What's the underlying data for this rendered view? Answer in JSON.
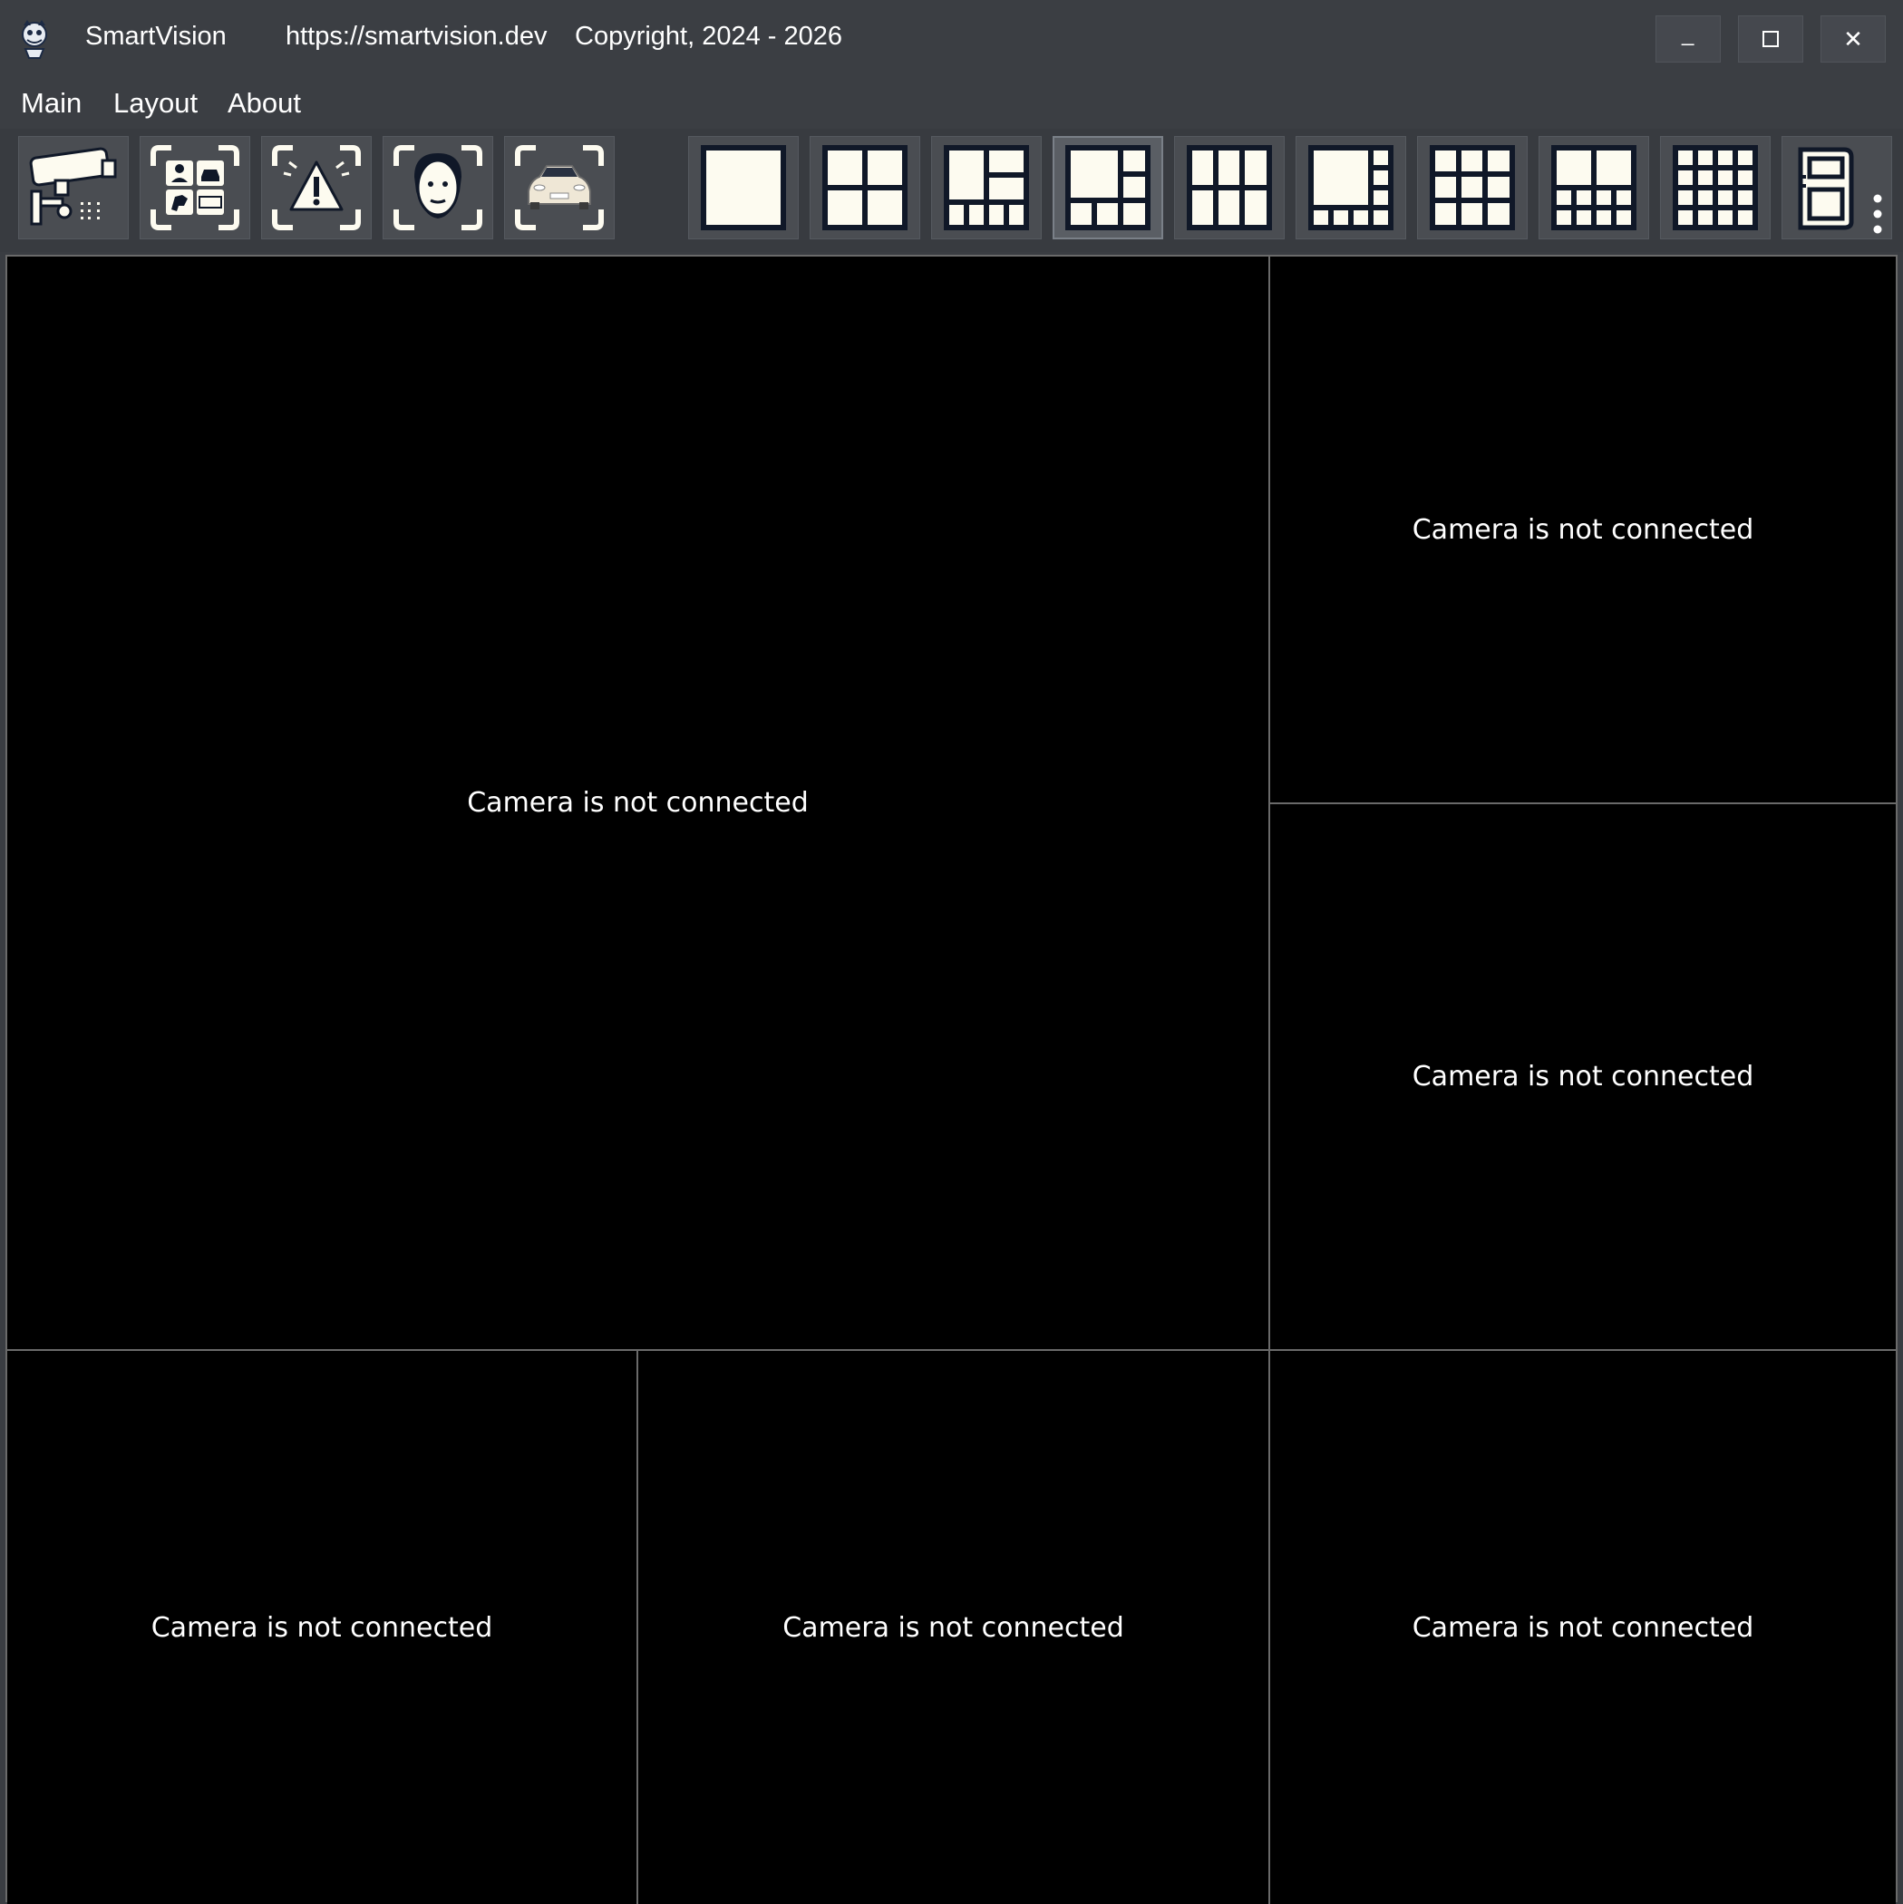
{
  "titlebar": {
    "app_name": "SmartVision",
    "url": "https://smartvision.dev",
    "copyright": "Copyright, 2024 - 2026",
    "minimize_label": "_",
    "close_label": "✕"
  },
  "menu": {
    "items": [
      "Main",
      "Layout",
      "About"
    ]
  },
  "toolbar": {
    "feature_buttons": [
      {
        "icon": "cctv-camera-icon"
      },
      {
        "icon": "object-detection-icon"
      },
      {
        "icon": "alert-icon"
      },
      {
        "icon": "face-recognition-icon"
      },
      {
        "icon": "vehicle-recognition-icon"
      }
    ],
    "layout_buttons": [
      {
        "icon": "layout-1-icon"
      },
      {
        "icon": "layout-4-icon"
      },
      {
        "icon": "layout-1-plus-4-icon"
      },
      {
        "icon": "layout-1-plus-5-icon",
        "selected": true
      },
      {
        "icon": "layout-6-icon"
      },
      {
        "icon": "layout-1-plus-7-icon"
      },
      {
        "icon": "layout-9-icon"
      },
      {
        "icon": "layout-1-plus-8-icon"
      },
      {
        "icon": "layout-16-icon"
      },
      {
        "icon": "custom-layout-icon"
      }
    ]
  },
  "cameras": [
    {
      "status": "Camera is not connected"
    },
    {
      "status": "Camera is not connected"
    },
    {
      "status": "Camera is not connected"
    },
    {
      "status": "Camera is not connected"
    },
    {
      "status": "Camera is not connected"
    },
    {
      "status": "Camera is not connected"
    }
  ],
  "colors": {
    "chrome": "#3b3e43",
    "button": "#4a4d52",
    "icon_fill": "#fdfbf0",
    "icon_stroke": "#101828",
    "video_bg": "#000000",
    "grid_line": "#6a6a6a"
  }
}
